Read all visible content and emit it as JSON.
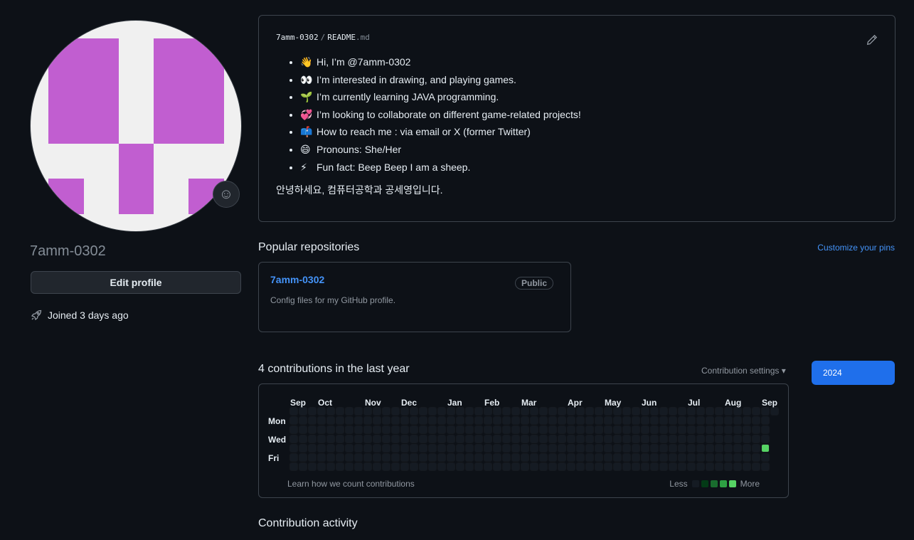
{
  "profile": {
    "username": "7amm-0302",
    "edit_label": "Edit profile",
    "joined": "Joined 3 days ago",
    "avatar_color": "#c15ed0"
  },
  "readme": {
    "owner": "7amm-0302",
    "separator": "/",
    "file_base": "README",
    "file_ext": ".md",
    "items": [
      {
        "emoji": "👋",
        "text": "Hi, I’m @7amm-0302"
      },
      {
        "emoji": "👀",
        "text": "I’m interested in drawing, and playing games."
      },
      {
        "emoji": "🌱",
        "text": "I’m currently learning JAVA programming."
      },
      {
        "emoji": "💞️",
        "text": "I’m looking to collaborate on different game-related projects!"
      },
      {
        "emoji": "📫",
        "text": "How to reach me : via email or X (former Twitter)"
      },
      {
        "emoji": "😄",
        "text": "Pronouns: She/Her"
      },
      {
        "emoji": "⚡",
        "text": "Fun fact: Beep Beep I am a sheep."
      }
    ],
    "korean_line": "안녕하세요, 컴퓨터공학과 공세영입니다."
  },
  "popular": {
    "title": "Popular repositories",
    "customize": "Customize your pins",
    "repo": {
      "name": "7amm-0302",
      "visibility": "Public",
      "description": "Config files for my GitHub profile."
    }
  },
  "contributions": {
    "title": "4 contributions in the last year",
    "settings": "Contribution settings ▾",
    "year": "2024",
    "months": [
      "Sep",
      "Oct",
      "Nov",
      "Dec",
      "Jan",
      "Feb",
      "Mar",
      "Apr",
      "May",
      "Jun",
      "Jul",
      "Aug",
      "Sep"
    ],
    "days": [
      "Mon",
      "Wed",
      "Fri"
    ],
    "learn": "Learn how we count contributions",
    "legend_less": "Less",
    "legend_more": "More",
    "legend_colors": [
      "#151b23",
      "#033a16",
      "#196c2e",
      "#2ea043",
      "#56d364"
    ],
    "active_color": "#56d364"
  },
  "activity": {
    "title": "Contribution activity"
  }
}
